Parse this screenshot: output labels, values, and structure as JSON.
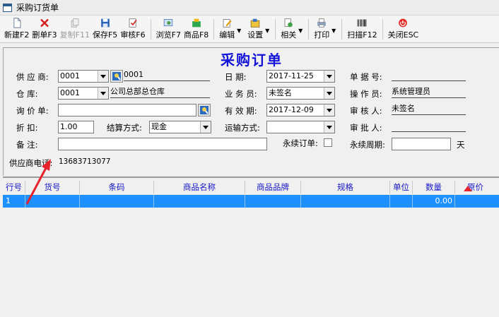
{
  "window": {
    "title": "采购订货单"
  },
  "toolbar": {
    "items": [
      {
        "label": "新建F2",
        "icon": "new-doc-icon",
        "enabled": true
      },
      {
        "label": "删单F3",
        "icon": "delete-icon",
        "enabled": true
      },
      {
        "label": "复制F11",
        "icon": "copy-icon",
        "enabled": false
      },
      {
        "label": "保存F5",
        "icon": "save-icon",
        "enabled": true
      },
      {
        "label": "审核F6",
        "icon": "audit-icon",
        "enabled": true
      },
      {
        "label": "浏览F7",
        "icon": "browse-icon",
        "enabled": true
      },
      {
        "label": "商品F8",
        "icon": "goods-icon",
        "enabled": true
      },
      {
        "label": "编辑",
        "icon": "edit-icon",
        "enabled": true
      },
      {
        "label": "设置",
        "icon": "settings-icon",
        "enabled": true
      },
      {
        "label": "相关",
        "icon": "related-icon",
        "enabled": true
      },
      {
        "label": "打印",
        "icon": "print-icon",
        "enabled": true
      },
      {
        "label": "扫描F12",
        "icon": "barcode-icon",
        "enabled": true
      },
      {
        "label": "关闭ESC",
        "icon": "close-icon",
        "enabled": true
      }
    ]
  },
  "form": {
    "title": "采购订单",
    "supplier": {
      "label": "供 应 商:",
      "code": "0001",
      "name": "0001"
    },
    "warehouse": {
      "label": "仓    库:",
      "code": "0001",
      "name": "公司总部总仓库"
    },
    "inquiry": {
      "label": "询 价 单:",
      "value": ""
    },
    "discount": {
      "label": "折    扣:",
      "value": "1.00"
    },
    "settlement": {
      "label": "结算方式:",
      "value": "现金"
    },
    "remark": {
      "label": "备    注:",
      "value": ""
    },
    "date": {
      "label": "日    期:",
      "value": "2017-11-25"
    },
    "salesman": {
      "label": "业 务 员:",
      "value": "未签名"
    },
    "validity": {
      "label": "有 效 期:",
      "value": "2017-12-09"
    },
    "shipping": {
      "label": "运输方式:",
      "value": ""
    },
    "permanent_order": {
      "label": "永续订单:",
      "checked": false
    },
    "doc_no": {
      "label": "单 据 号:",
      "value": ""
    },
    "operator": {
      "label": "操 作 员:",
      "value": "系统管理员"
    },
    "auditor": {
      "label": "审 核 人:",
      "value": "未签名"
    },
    "approver": {
      "label": "审 批 人:",
      "value": ""
    },
    "cycle": {
      "label": "永续周期:",
      "value": "",
      "unit": "天"
    },
    "supplier_phone": {
      "label": "供应商电话:",
      "value": "13683713077"
    }
  },
  "grid": {
    "columns": [
      "行号",
      "货号",
      "条码",
      "商品名称",
      "商品品牌",
      "规格",
      "单位",
      "数量",
      "原价"
    ],
    "rows": [
      {
        "line": "1",
        "item_no": "",
        "barcode": "",
        "name": "",
        "brand": "",
        "spec": "",
        "unit": "",
        "qty": "0.00",
        "price": ""
      }
    ],
    "selection_color": "#1e90ff",
    "header_text_color": "#1717c8"
  },
  "colors": {
    "title_blue": "#1212d8",
    "annotation_red": "#e8212b"
  }
}
